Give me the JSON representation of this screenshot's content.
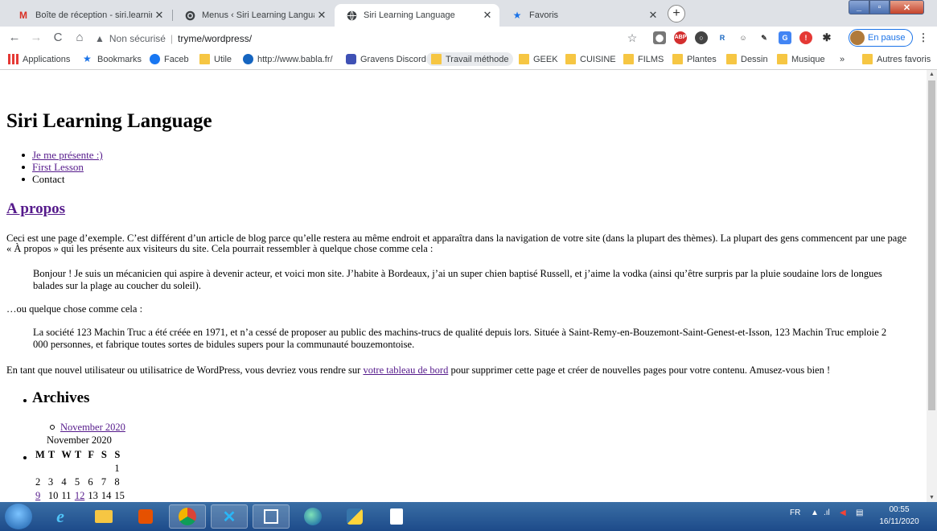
{
  "browser": {
    "tabs": [
      {
        "label": "Boîte de réception - siri.learning.l",
        "icon": "gmail-icon",
        "active": false
      },
      {
        "label": "Menus ‹ Siri Learning Language",
        "icon": "wordpress-icon",
        "active": false
      },
      {
        "label": "Siri Learning Language",
        "icon": "globe-icon",
        "active": true
      },
      {
        "label": "Favoris",
        "icon": "star-icon",
        "active": false
      }
    ],
    "address": {
      "security": "Non sécurisé",
      "url": "tryme/wordpress/"
    },
    "profile_status": "En pause",
    "bookmarks": [
      {
        "label": "Applications",
        "icon": "apps-icon"
      },
      {
        "label": "Bookmarks",
        "icon": "star-icon"
      },
      {
        "label": "Faceb",
        "icon": "facebook-icon"
      },
      {
        "label": "Utile",
        "icon": "folder-icon"
      },
      {
        "label": "http://www.babla.fr/",
        "icon": "bubble-icon"
      },
      {
        "label": "Gravens Discord",
        "icon": "bookmark-icon"
      },
      {
        "label": "Travail méthode",
        "icon": "folder-icon"
      },
      {
        "label": "GEEK",
        "icon": "folder-icon"
      },
      {
        "label": "CUISINE",
        "icon": "folder-icon"
      },
      {
        "label": "FILMS",
        "icon": "folder-icon"
      },
      {
        "label": "Plantes",
        "icon": "folder-icon"
      },
      {
        "label": "Dessin",
        "icon": "folder-icon"
      },
      {
        "label": "Musique",
        "icon": "folder-icon"
      },
      {
        "label": "»",
        "icon": ""
      },
      {
        "label": "Autres favoris",
        "icon": "folder-icon"
      }
    ]
  },
  "page": {
    "site_title": "Siri Learning Language",
    "menu": [
      {
        "label": "Je me présente :)",
        "link": true
      },
      {
        "label": "First Lesson",
        "link": true
      },
      {
        "label": "Contact",
        "link": false
      }
    ],
    "title": "A propos",
    "intro": "Ceci est une page d’exemple. C’est différent d’un article de blog parce qu’elle restera au même endroit et apparaîtra dans la navigation de votre site (dans la plupart des thèmes). La plupart des gens commencent par une page « À propos » qui les présente aux visiteurs du site. Cela pourrait ressembler à quelque chose comme cela :",
    "quote1": "Bonjour ! Je suis un mécanicien qui aspire à devenir acteur, et voici mon site. J’habite à Bordeaux, j’ai un super chien baptisé Russell, et j’aime la vodka (ainsi qu’être surpris par la pluie soudaine lors de longues balades sur la plage au coucher du soleil).",
    "or_text": "…ou quelque chose comme cela :",
    "quote2": "La société 123 Machin Truc a été créée en 1971, et n’a cessé de proposer au public des machins-trucs de qualité depuis lors. Située à Saint-Remy-en-Bouzemont-Saint-Genest-et-Isson, 123 Machin Truc emploie 2 000 personnes, et fabrique toutes sortes de bidules supers pour la communauté bouzemontoise.",
    "outro_before": "En tant que nouvel utilisateur ou utilisatrice de WordPress, vous devriez vous rendre sur ",
    "outro_link": "votre tableau de bord",
    "outro_after": " pour supprimer cette page et créer de nouvelles pages pour votre contenu. Amusez-vous bien !",
    "archives_title": "Archives",
    "archive_link": "November 2020",
    "calendar": {
      "caption": "November 2020",
      "headers": [
        "M",
        "T",
        "W",
        "T",
        "F",
        "S",
        "S"
      ],
      "rows": [
        [
          "",
          "",
          "",
          "",
          "",
          "",
          "1"
        ],
        [
          "2",
          "3",
          "4",
          "5",
          "6",
          "7",
          "8"
        ],
        [
          "9",
          "10",
          "11",
          "12",
          "13",
          "14",
          "15"
        ]
      ],
      "linked_days": [
        "9",
        "12"
      ]
    }
  },
  "taskbar": {
    "lang": "FR",
    "time": "00:55",
    "date": "16/11/2020"
  }
}
